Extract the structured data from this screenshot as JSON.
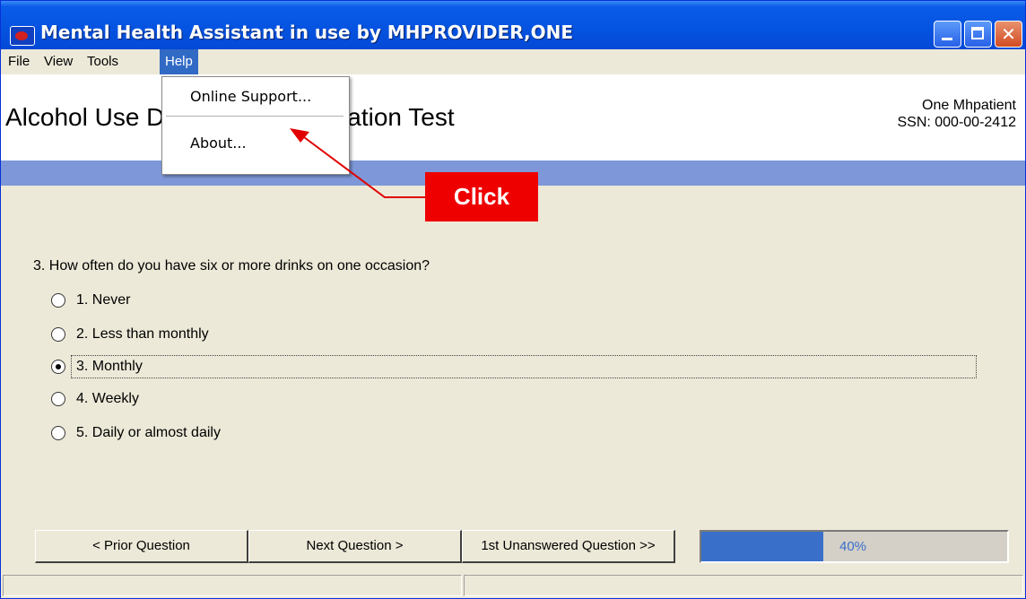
{
  "window": {
    "title": "Mental Health Assistant in use by MHPROVIDER,ONE"
  },
  "menubar": {
    "items": [
      "File",
      "View",
      "Tools",
      "Help"
    ],
    "active": "Help"
  },
  "help_menu": {
    "items": [
      "Online Support...",
      "About..."
    ]
  },
  "header": {
    "title": "Alcohol Use Disorders Identification Test",
    "patient_name": "One Mhpatient",
    "patient_ssn": "SSN: 000-00-2412"
  },
  "question": {
    "text": "3. How often do you have six or more drinks on one occasion?",
    "options": [
      "1. Never",
      "2. Less than monthly",
      "3. Monthly",
      "4. Weekly",
      "5. Daily or almost daily"
    ],
    "selected_index": 2
  },
  "nav": {
    "prior": "< Prior Question",
    "next": "Next Question >",
    "first_unanswered": "1st Unanswered Question >>"
  },
  "progress": {
    "value": 40,
    "label": "40%"
  },
  "annotation": {
    "callout": "Click"
  },
  "colors": {
    "title_bar": "#0554E1",
    "menu_highlight": "#316AC5",
    "band": "#7E97D8",
    "progress_fill": "#3A6FC9",
    "callout": "#EE0000"
  }
}
